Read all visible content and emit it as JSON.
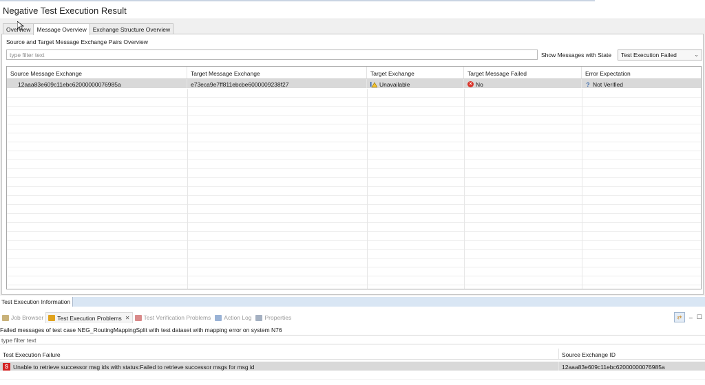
{
  "header": {
    "title": "Negative Test Execution Result"
  },
  "tabs": [
    {
      "label": "Overview"
    },
    {
      "label": "Message Overview"
    },
    {
      "label": "Exchange Structure Overview"
    }
  ],
  "message_overview": {
    "section_title": "Source and Target Message Exchange Pairs Overview",
    "filter_placeholder": "type filter text",
    "state_label": "Show Messages with State",
    "state_value": "Test Execution Failed",
    "columns": [
      "Source Message Exchange",
      "Target Message Exchange",
      "Target Exchange",
      "Target Message Failed",
      "Error Expectation"
    ],
    "rows": [
      {
        "source": "12aaa83e609c11ebc62000000076985a",
        "target": "e73eca9e7ff811ebcbe6000009238f27",
        "target_exchange": "Unavailable",
        "target_failed": "No",
        "error_expectation": "Not Verified"
      }
    ]
  },
  "info_panel": {
    "tab_label": "Test Execution Information"
  },
  "views": [
    {
      "label": "Job Browser",
      "icon": "job-browser-icon",
      "color": "#c9b27a"
    },
    {
      "label": "Test Execution Problems",
      "icon": "test-problems-icon",
      "color": "#e0a31f"
    },
    {
      "label": "Test Verification Problems",
      "icon": "verification-problems-icon",
      "color": "#d98a8a"
    },
    {
      "label": "Action Log",
      "icon": "action-log-icon",
      "color": "#9ab3d6"
    },
    {
      "label": "Properties",
      "icon": "properties-icon",
      "color": "#a5b1c2"
    }
  ],
  "problems": {
    "description": "Failed messages of test case NEG_RoutingMappingSplit with test dataset with mapping error on system N76",
    "filter_placeholder": "type filter text",
    "columns": [
      "Test Execution Failure",
      "Source Exchange ID"
    ],
    "rows": [
      {
        "failure": "Unable to retrieve successor msg ids with status:Failed to retrieve successor msgs for msg id",
        "source_id": "12aaa83e609c11ebc62000000076985a"
      }
    ]
  }
}
